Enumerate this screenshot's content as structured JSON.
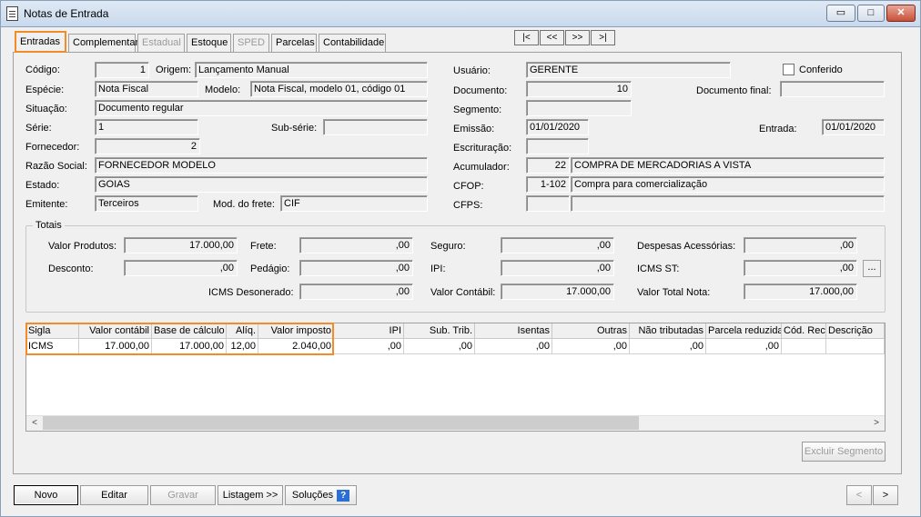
{
  "window": {
    "title": "Notas de Entrada",
    "minimize": "▭",
    "maximize": "□",
    "close": "✕"
  },
  "tabs": [
    {
      "label": "Entradas",
      "state": "active"
    },
    {
      "label": "Complementar",
      "state": "normal"
    },
    {
      "label": "Estadual",
      "state": "disabled"
    },
    {
      "label": "Estoque",
      "state": "normal"
    },
    {
      "label": "SPED",
      "state": "disabled"
    },
    {
      "label": "Parcelas",
      "state": "normal"
    },
    {
      "label": "Contabilidade",
      "state": "normal"
    }
  ],
  "nav": {
    "first": "|<",
    "prev": "<<",
    "next": ">>",
    "last": ">|"
  },
  "form": {
    "codigo": {
      "label": "Código:",
      "value": "1"
    },
    "origem": {
      "label": "Origem:",
      "value": "Lançamento Manual"
    },
    "especie": {
      "label": "Espécie:",
      "value": "Nota Fiscal"
    },
    "modelo": {
      "label": "Modelo:",
      "value": "Nota Fiscal, modelo 01, código 01"
    },
    "situacao": {
      "label": "Situação:",
      "value": "Documento regular"
    },
    "serie": {
      "label": "Série:",
      "value": "1"
    },
    "subserie": {
      "label": "Sub-série:",
      "value": ""
    },
    "fornecedor": {
      "label": "Fornecedor:",
      "value": "2"
    },
    "razao": {
      "label": "Razão Social:",
      "value": "FORNECEDOR MODELO"
    },
    "estado": {
      "label": "Estado:",
      "value": "GOIAS"
    },
    "emitente": {
      "label": "Emitente:",
      "value": "Terceiros"
    },
    "frete": {
      "label": "Mod. do frete:",
      "value": "CIF"
    },
    "usuario": {
      "label": "Usuário:",
      "value": "GERENTE"
    },
    "conferido": {
      "label": "Conferido",
      "checked": false
    },
    "documento": {
      "label": "Documento:",
      "value": "10"
    },
    "documento_final": {
      "label": "Documento final:",
      "value": ""
    },
    "segmento": {
      "label": "Segmento:",
      "value": ""
    },
    "emissao": {
      "label": "Emissão:",
      "value": "01/01/2020"
    },
    "entrada": {
      "label": "Entrada:",
      "value": "01/01/2020"
    },
    "escrituracao": {
      "label": "Escrituração:",
      "value": ""
    },
    "acumulador": {
      "label": "Acumulador:",
      "code": "22",
      "value": "COMPRA DE MERCADORIAS A VISTA"
    },
    "cfop": {
      "label": "CFOP:",
      "code": "1-102",
      "value": "Compra para comercialização"
    },
    "cfps": {
      "label": "CFPS:",
      "code": "",
      "value": ""
    }
  },
  "totais": {
    "title": "Totais",
    "valor_produtos": {
      "label": "Valor Produtos:",
      "value": "17.000,00"
    },
    "frete": {
      "label": "Frete:",
      "value": ",00"
    },
    "seguro": {
      "label": "Seguro:",
      "value": ",00"
    },
    "despesas": {
      "label": "Despesas Acessórias:",
      "value": ",00"
    },
    "desconto": {
      "label": "Desconto:",
      "value": ",00"
    },
    "pedagio": {
      "label": "Pedágio:",
      "value": ",00"
    },
    "ipi": {
      "label": "IPI:",
      "value": ",00"
    },
    "icms_st": {
      "label": "ICMS ST:",
      "value": ",00",
      "button": "..."
    },
    "icms_desonerado": {
      "label": "ICMS Desonerado:",
      "value": ",00"
    },
    "valor_contabil": {
      "label": "Valor Contábil:",
      "value": "17.000,00"
    },
    "valor_total": {
      "label": "Valor Total Nota:",
      "value": "17.000,00"
    }
  },
  "grid": {
    "columns": [
      "Sigla",
      "Valor contábil",
      "Base de cálculo",
      "Alíq.",
      "Valor imposto",
      "IPI",
      "Sub. Trib.",
      "Isentas",
      "Outras",
      "Não tributadas",
      "Parcela reduzida",
      "Cód. Rec.",
      "Descrição"
    ],
    "rows": [
      [
        "ICMS",
        "17.000,00",
        "17.000,00",
        "12,00",
        "2.040,00",
        ",00",
        ",00",
        ",00",
        ",00",
        ",00",
        ",00",
        "",
        ""
      ]
    ],
    "scroll_left": "<",
    "scroll_right": ">"
  },
  "actions": {
    "excluir_segmento": "Excluir Segmento",
    "novo": "Novo",
    "editar": "Editar",
    "gravar": "Gravar",
    "listagem": "Listagem >>",
    "solucoes": "Soluções",
    "help": "?",
    "prev": "<",
    "next": ">"
  }
}
